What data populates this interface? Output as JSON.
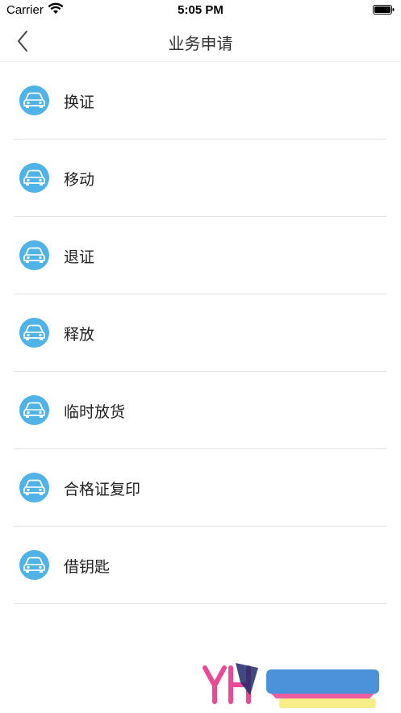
{
  "status_bar": {
    "carrier": "Carrier",
    "time": "5:05 PM"
  },
  "nav": {
    "title": "业务申请",
    "back_icon": "chevron-left-icon"
  },
  "items": [
    {
      "label": "换证",
      "icon": "car-icon"
    },
    {
      "label": "移动",
      "icon": "car-icon"
    },
    {
      "label": "退证",
      "icon": "car-icon"
    },
    {
      "label": "释放",
      "icon": "car-icon"
    },
    {
      "label": "临时放货",
      "icon": "car-icon"
    },
    {
      "label": "合格证复印",
      "icon": "car-icon"
    },
    {
      "label": "借钥匙",
      "icon": "car-icon"
    }
  ],
  "colors": {
    "icon_bg": "#4fb3e8",
    "divider": "#e2e2e2"
  }
}
